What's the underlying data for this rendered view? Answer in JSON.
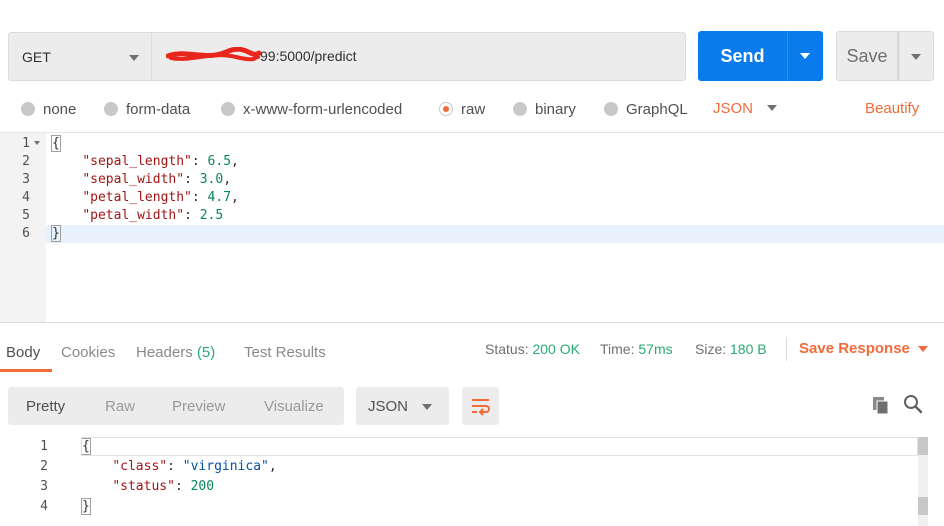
{
  "request": {
    "method": "GET",
    "url_visible": "99:5000/predict",
    "send_label": "Send",
    "save_label": "Save"
  },
  "body_types": {
    "options": [
      "none",
      "form-data",
      "x-www-form-urlencoded",
      "raw",
      "binary",
      "GraphQL"
    ],
    "selected": "raw",
    "format": "JSON",
    "beautify_label": "Beautify"
  },
  "request_body": {
    "line_numbers": [
      "1",
      "2",
      "3",
      "4",
      "5",
      "6"
    ],
    "lines": [
      {
        "text": "{"
      },
      {
        "key": "\"sepal_length\"",
        "value": "6.5",
        "trail": ","
      },
      {
        "key": "\"sepal_width\"",
        "value": "3.0",
        "trail": ","
      },
      {
        "key": "\"petal_length\"",
        "value": "4.7",
        "trail": ","
      },
      {
        "key": "\"petal_width\"",
        "value": "2.5",
        "trail": ""
      },
      {
        "text": "}"
      }
    ]
  },
  "response": {
    "tabs": {
      "body": "Body",
      "cookies": "Cookies",
      "headers": "Headers",
      "headers_count": "(5)",
      "tests": "Test Results"
    },
    "status_label": "Status:",
    "status_value": "200 OK",
    "time_label": "Time:",
    "time_value": "57ms",
    "size_label": "Size:",
    "size_value": "180 B",
    "save_response_label": "Save Response",
    "views": [
      "Pretty",
      "Raw",
      "Preview",
      "Visualize"
    ],
    "active_view": "Pretty",
    "format": "JSON",
    "line_numbers": [
      "1",
      "2",
      "3",
      "4"
    ],
    "lines": [
      {
        "text": "{"
      },
      {
        "key": "\"class\"",
        "value": "\"virginica\"",
        "trail": ","
      },
      {
        "key": "\"status\"",
        "value": "200",
        "trail": ""
      },
      {
        "text": "}"
      }
    ]
  },
  "colors": {
    "accent_orange": "#f26b3a",
    "send_blue": "#097bed",
    "success_green": "#2aa876"
  }
}
